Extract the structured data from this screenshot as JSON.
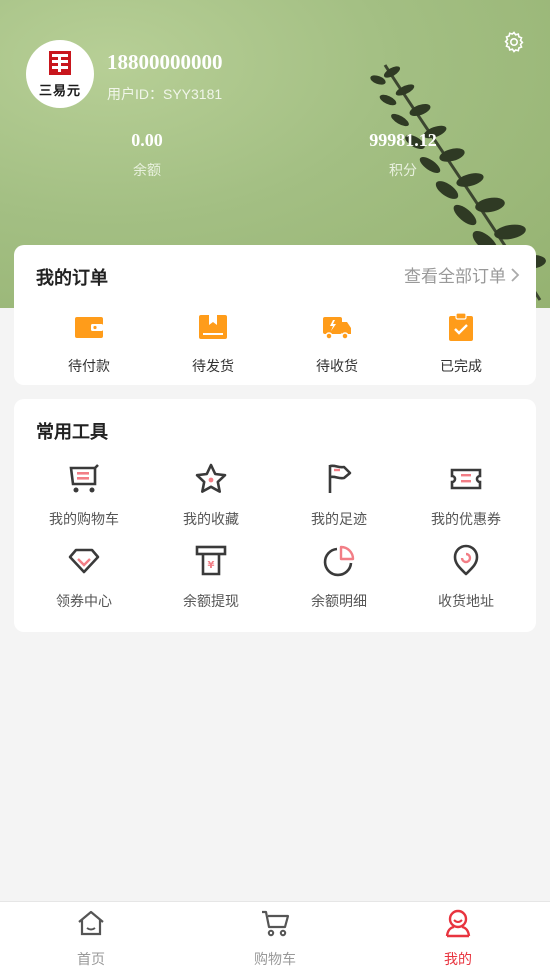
{
  "user": {
    "phone": "18800000000",
    "uid_text": "用户ID：SYY3181",
    "logo_text": "三易元"
  },
  "stats": [
    {
      "value": "0.00",
      "label": "余额"
    },
    {
      "value": "99981.12",
      "label": "积分"
    }
  ],
  "orders": {
    "title": "我的订单",
    "view_all": "查看全部订单",
    "items": [
      {
        "label": "待付款",
        "icon": "wallet-icon"
      },
      {
        "label": "待发货",
        "icon": "package-icon"
      },
      {
        "label": "待收货",
        "icon": "truck-icon"
      },
      {
        "label": "已完成",
        "icon": "clipboard-check-icon"
      }
    ]
  },
  "tools": {
    "title": "常用工具",
    "items": [
      {
        "label": "我的购物车",
        "icon": "cart-icon"
      },
      {
        "label": "我的收藏",
        "icon": "star-icon"
      },
      {
        "label": "我的足迹",
        "icon": "flag-icon"
      },
      {
        "label": "我的优惠券",
        "icon": "coupon-icon"
      },
      {
        "label": "领券中心",
        "icon": "diamond-icon"
      },
      {
        "label": "余额提现",
        "icon": "withdraw-icon"
      },
      {
        "label": "余额明细",
        "icon": "pie-chart-icon"
      },
      {
        "label": "收货地址",
        "icon": "location-pin-icon"
      }
    ]
  },
  "tabbar": {
    "active_index": 2,
    "items": [
      {
        "label": "首页",
        "icon": "home-icon"
      },
      {
        "label": "购物车",
        "icon": "cart-icon"
      },
      {
        "label": "我的",
        "icon": "user-icon"
      }
    ]
  },
  "colors": {
    "accent_orange": "#ff9c1a",
    "active_red": "#e8343f",
    "tool_pink": "#f27e86",
    "tool_dark": "#3a3a3a",
    "hero_green": "#a3bf83"
  }
}
